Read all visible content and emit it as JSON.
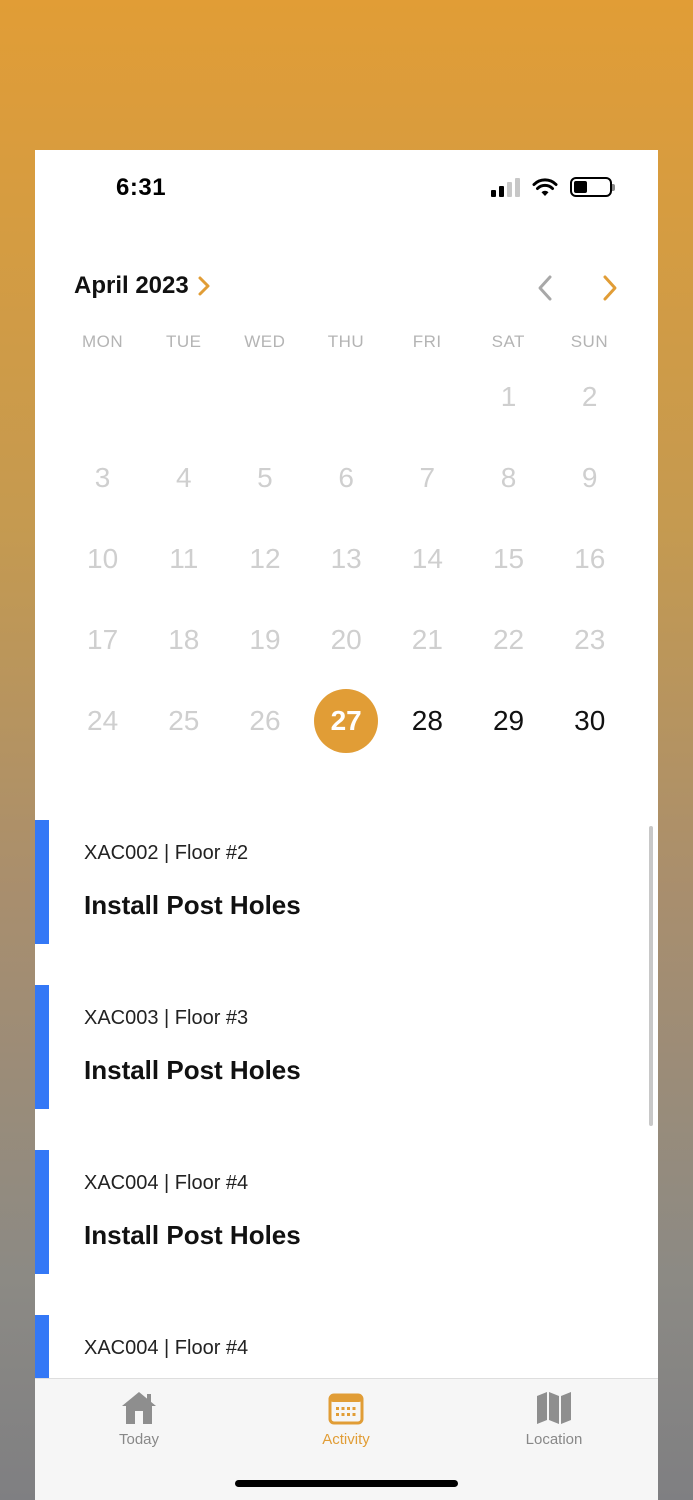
{
  "status_bar": {
    "time": "6:31"
  },
  "calendar": {
    "month_title": "April 2023",
    "weekdays": [
      "MON",
      "TUE",
      "WED",
      "THU",
      "FRI",
      "SAT",
      "SUN"
    ],
    "selected_day": "27",
    "weeks": [
      [
        "",
        "",
        "",
        "",
        "",
        "1",
        "2"
      ],
      [
        "3",
        "4",
        "5",
        "6",
        "7",
        "8",
        "9"
      ],
      [
        "10",
        "11",
        "12",
        "13",
        "14",
        "15",
        "16"
      ],
      [
        "17",
        "18",
        "19",
        "20",
        "21",
        "22",
        "23"
      ],
      [
        "24",
        "25",
        "26",
        "27",
        "28",
        "29",
        "30"
      ]
    ],
    "active_days": [
      "28",
      "29",
      "30"
    ]
  },
  "tasks": [
    {
      "code": "XAC002 | Floor #2",
      "title": "Install Post Holes"
    },
    {
      "code": "XAC003 | Floor #3",
      "title": "Install Post Holes"
    },
    {
      "code": "XAC004 | Floor #4",
      "title": "Install Post Holes"
    },
    {
      "code": "XAC004 | Floor #4",
      "title": ""
    }
  ],
  "tabbar": {
    "items": [
      {
        "label": "Today",
        "icon": "home-icon"
      },
      {
        "label": "Activity",
        "icon": "calendar-icon",
        "active": true
      },
      {
        "label": "Location",
        "icon": "map-icon"
      }
    ]
  },
  "colors": {
    "accent": "#e19d36",
    "task_bar": "#3478f6",
    "inactive_day": "#cfcfcf"
  }
}
